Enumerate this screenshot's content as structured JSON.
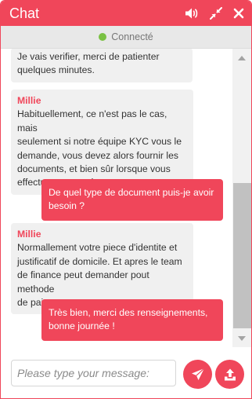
{
  "header": {
    "title": "Chat",
    "sound_icon": "speaker-icon",
    "collapse_icon": "collapse-arrows-icon",
    "close_icon": "close-icon"
  },
  "status": {
    "label": "Connecté",
    "color": "#7ac143"
  },
  "colors": {
    "accent": "#f0465a",
    "agent_bubble": "#f0f0f0",
    "status_bar": "#e8e8e8"
  },
  "messages": [
    {
      "from": "agent",
      "sender": "",
      "lines": [
        "Je vais verifier, merci de patienter",
        "quelques minutes."
      ]
    },
    {
      "from": "agent",
      "sender": "Millie",
      "lines": [
        "Habituellement, ce n'est pas le cas, mais",
        "seulement si notre équipe KYC vous le",
        "demande, vous devez alors fournir les",
        "documents, et bien sûr lorsque vous",
        "effectuez un retrait."
      ]
    },
    {
      "from": "user",
      "lines": [
        "De quel type de document puis-je avoir",
        "besoin ?"
      ]
    },
    {
      "from": "agent",
      "sender": "Millie",
      "lines": [
        "Normallement votre piece d'identite et",
        "justificatif de domicile. Et apres le team",
        "de finance peut demander pout methode",
        "de paiement."
      ]
    },
    {
      "from": "user",
      "lines": [
        "Très bien, merci des renseignements,",
        "bonne journée !"
      ]
    }
  ],
  "composer": {
    "placeholder": "Please type your message:",
    "value": "",
    "send_icon": "paper-plane-icon",
    "upload_icon": "upload-icon"
  }
}
